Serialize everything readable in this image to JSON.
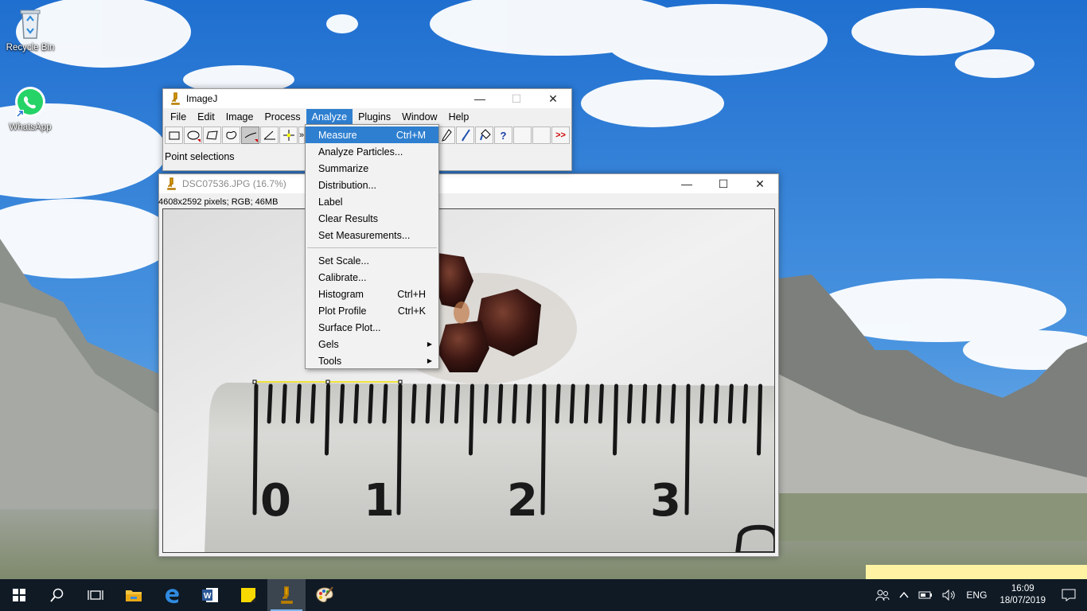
{
  "desktop": {
    "icons": [
      {
        "label": "Recycle Bin",
        "icon": "recycle-bin-icon"
      },
      {
        "label": "WhatsApp",
        "icon": "whatsapp-icon"
      }
    ]
  },
  "imagej": {
    "title": "ImageJ",
    "menus": [
      "File",
      "Edit",
      "Image",
      "Process",
      "Analyze",
      "Plugins",
      "Window",
      "Help"
    ],
    "active_menu": "Analyze",
    "status": "Point selections",
    "tools": [
      "rectangle-tool",
      "oval-tool",
      "polygon-tool",
      "freehand-tool",
      "line-tool",
      "angle-tool",
      "point-tool",
      "more-tools",
      "dropper-tool",
      "brush-tool",
      "flood-fill-tool",
      "help-tool",
      "blank-tool-1",
      "blank-tool-2",
      "more-tools-menu"
    ],
    "more_tools_label": ">>"
  },
  "analyze_menu": {
    "items": [
      {
        "label": "Measure",
        "shortcut": "Ctrl+M",
        "highlighted": true
      },
      {
        "label": "Analyze Particles...",
        "shortcut": ""
      },
      {
        "label": "Summarize",
        "shortcut": ""
      },
      {
        "label": "Distribution...",
        "shortcut": ""
      },
      {
        "label": "Label",
        "shortcut": ""
      },
      {
        "label": "Clear Results",
        "shortcut": ""
      },
      {
        "label": "Set Measurements...",
        "shortcut": ""
      },
      {
        "label": "Set Scale...",
        "shortcut": ""
      },
      {
        "label": "Calibrate...",
        "shortcut": ""
      },
      {
        "label": "Histogram",
        "shortcut": "Ctrl+H"
      },
      {
        "label": "Plot Profile",
        "shortcut": "Ctrl+K"
      },
      {
        "label": "Surface Plot...",
        "shortcut": ""
      },
      {
        "label": "Gels",
        "shortcut": "",
        "submenu": true
      },
      {
        "label": "Tools",
        "shortcut": "",
        "submenu": true
      }
    ]
  },
  "image_window": {
    "title": "DSC07536.JPG (16.7%)",
    "info": "4608x2592 pixels; RGB; 46MB",
    "ruler_numbers": [
      "0",
      "1",
      "2",
      "3"
    ]
  },
  "taskbar": {
    "apps": [
      "start-button",
      "search-button",
      "task-view-button",
      "file-explorer",
      "edge-browser",
      "word",
      "sticky-notes",
      "imagej",
      "paint"
    ],
    "language": "ENG",
    "time": "16:09",
    "date": "18/07/2019"
  }
}
